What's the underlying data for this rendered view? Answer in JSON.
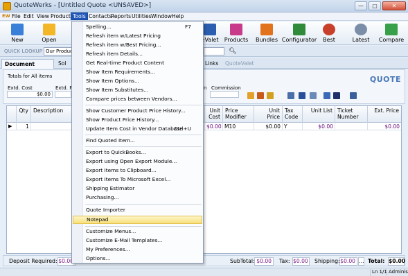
{
  "window": {
    "title": "QuoteWerks - [Untitled Quote <UNSAVED>]",
    "controls": [
      "—",
      "▢",
      "✕"
    ]
  },
  "menubar": {
    "brand": "EW",
    "items": [
      "File",
      "Edit",
      "View",
      "Products",
      "Tools",
      "Contacts",
      "Reports",
      "Utilities",
      "Window",
      "Help"
    ],
    "active": "Tools"
  },
  "toolbar": {
    "items": [
      {
        "label": "New",
        "icon": "new-icon",
        "color": "#3a7fd8"
      },
      {
        "label": "Open",
        "icon": "folder-icon",
        "color": "#f2b626"
      },
      {
        "label": "eValet",
        "icon": "quotevalet-icon",
        "color": "#2a5fb0"
      },
      {
        "label": "Products",
        "icon": "products-icon",
        "color": "#c83a8a"
      },
      {
        "label": "Bundles",
        "icon": "bundles-icon",
        "color": "#e2731c"
      },
      {
        "label": "Configurator",
        "icon": "configurator-icon",
        "color": "#2f8a3a"
      },
      {
        "label": "Best",
        "icon": "best-icon",
        "color": "#c8402a"
      },
      {
        "label": "Latest",
        "icon": "latest-icon",
        "color": "#7a8ea8"
      },
      {
        "label": "Compare",
        "icon": "compare-icon",
        "color": "#38a04a"
      }
    ]
  },
  "quick_lookup": {
    "label": "QUICK LOOKUP",
    "value": "Our Product"
  },
  "tabs": {
    "items": [
      "Document Items",
      "Sol",
      "Links",
      "QuoteValet"
    ]
  },
  "totals": {
    "title": "Totals for All items",
    "extd_cost_label": "Extd. Cost",
    "extd_cost_value": "$0.00",
    "extd_price_label": "Extd. P",
    "min_label": "in",
    "commission_label": "Commission",
    "quote_label": "QUOTE"
  },
  "grid": {
    "headers": [
      {
        "text": "Qty",
        "align": "r"
      },
      {
        "text": "Description",
        "align": "l"
      },
      {
        "text": "Unit Cost",
        "align": "r"
      },
      {
        "text": "Price Modifier",
        "align": "l"
      },
      {
        "text": "Unit Price",
        "align": "r"
      },
      {
        "text": "Tax Code",
        "align": "l"
      },
      {
        "text": "Unit List",
        "align": "r"
      },
      {
        "text": "Ticket Number",
        "align": "l"
      },
      {
        "text": "Ext. Price",
        "align": "r"
      }
    ],
    "row": {
      "qty": "1",
      "description": "",
      "unit_cost": "$0.00",
      "price_modifier": "M10",
      "unit_price": "$0.00",
      "tax_code": "Y",
      "unit_list": "$0.00",
      "ticket_number": "",
      "ext_price": "$0.00"
    }
  },
  "summary": {
    "deposit_label": "Deposit Required:",
    "deposit_value": "$0.00",
    "subtotal_label": "SubTotal:",
    "subtotal_value": "$0.00",
    "tax_label": "Tax:",
    "tax_value": "$0.00",
    "shipping_label": "Shipping:",
    "shipping_value": "$0.00",
    "total_label": "Total:",
    "total_value": "$0.00"
  },
  "statusbar": {
    "position": "Ln 1/1",
    "user": "Administrator"
  },
  "tools_menu": {
    "items": [
      {
        "label": "Spelling...",
        "shortcut": "F7"
      },
      {
        "label": "Refresh item w/Latest Pricing",
        "shortcut": ""
      },
      {
        "label": "Refresh item w/Best Pricing...",
        "shortcut": ""
      },
      {
        "label": "Refresh item Details...",
        "shortcut": ""
      },
      {
        "label": "Get Real-time Product Content",
        "shortcut": ""
      },
      {
        "label": "Show Item Requirements...",
        "shortcut": ""
      },
      {
        "label": "Show Item Options...",
        "shortcut": ""
      },
      {
        "label": "Show Item Substitutes...",
        "shortcut": ""
      },
      {
        "label": "Compare prices between Vendors...",
        "shortcut": ""
      },
      {
        "label": "Show Customer Product Price History...",
        "shortcut": ""
      },
      {
        "label": "Show Product Price History...",
        "shortcut": ""
      },
      {
        "label": "Update Item Cost in Vendor Database",
        "shortcut": "Ctrl+U"
      },
      {
        "label": "Find Quoted Item...",
        "shortcut": ""
      },
      {
        "label": "Export to QuickBooks...",
        "shortcut": ""
      },
      {
        "label": "Export using Open Export Module...",
        "shortcut": ""
      },
      {
        "label": "Export Items to Clipboard...",
        "shortcut": ""
      },
      {
        "label": "Export Items To Microsoft Excel...",
        "shortcut": ""
      },
      {
        "label": "Shipping Estimator",
        "shortcut": ""
      },
      {
        "label": "Purchasing...",
        "shortcut": ""
      },
      {
        "label": "Quote Importer",
        "shortcut": ""
      },
      {
        "label": "Notepad",
        "shortcut": ""
      },
      {
        "label": "Customize Menus...",
        "shortcut": ""
      },
      {
        "label": "Customize E-Mail Templates...",
        "shortcut": ""
      },
      {
        "label": "My Preferences...",
        "shortcut": ""
      },
      {
        "label": "Options...",
        "shortcut": ""
      }
    ],
    "highlighted": "Notepad"
  }
}
